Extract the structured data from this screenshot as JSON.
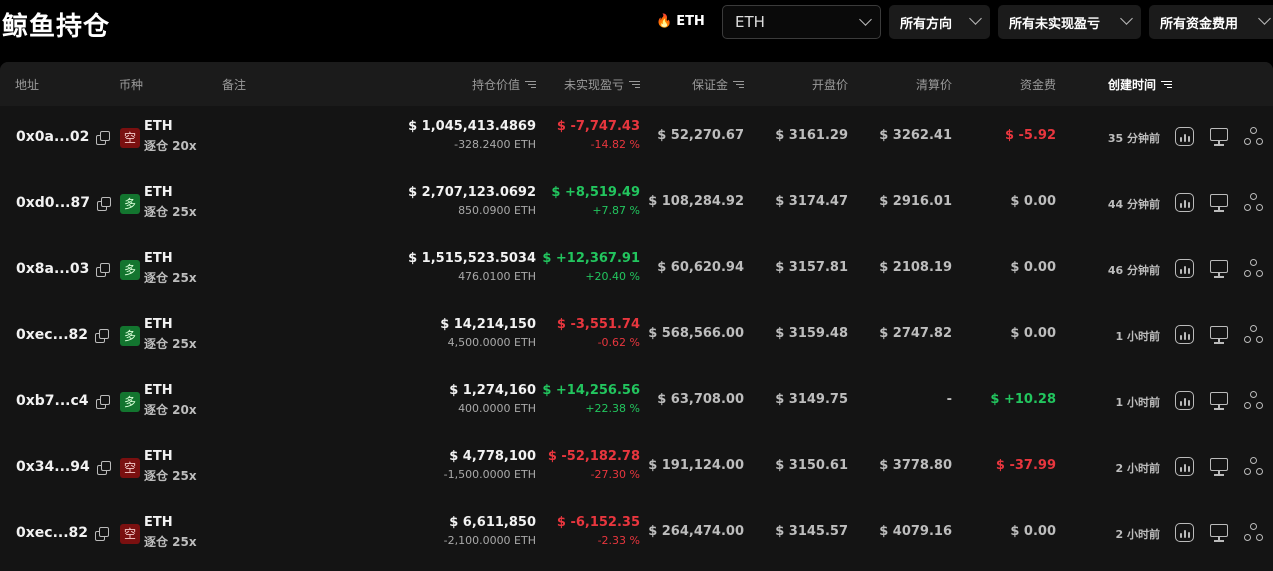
{
  "page": {
    "title": "鲸鱼持仓"
  },
  "filters": {
    "asset_chip": "ETH",
    "symbol_select": "ETH",
    "direction_select": "所有方向",
    "pnl_select": "所有未实现盈亏",
    "funding_select": "所有资金费用"
  },
  "table": {
    "columns": {
      "address": "地址",
      "coin": "币种",
      "note": "备注",
      "position_value": "持仓价值",
      "unrealized_pnl": "未实现盈亏",
      "margin": "保证金",
      "open_price": "开盘价",
      "liq_price": "清算价",
      "funding": "资金费",
      "created": "创建时间"
    },
    "rows": [
      {
        "address": "0x0a...02",
        "side": "空",
        "side_type": "short",
        "coin": "ETH",
        "leverage": "逐仓 20x",
        "value": "$ 1,045,413.4869",
        "size": "-328.2400 ETH",
        "pnl": "$ -7,747.43",
        "pnl_pct": "-14.82 %",
        "pnl_type": "red",
        "margin": "$ 52,270.67",
        "open": "$ 3161.29",
        "liq": "$ 3262.41",
        "funding": "$ -5.92",
        "funding_type": "red",
        "time": "35 分钟前"
      },
      {
        "address": "0xd0...87",
        "side": "多",
        "side_type": "long",
        "coin": "ETH",
        "leverage": "逐仓 25x",
        "value": "$ 2,707,123.0692",
        "size": "850.0900 ETH",
        "pnl": "$ +8,519.49",
        "pnl_pct": "+7.87 %",
        "pnl_type": "green",
        "margin": "$ 108,284.92",
        "open": "$ 3174.47",
        "liq": "$ 2916.01",
        "funding": "$ 0.00",
        "funding_type": "neutral",
        "time": "44 分钟前"
      },
      {
        "address": "0x8a...03",
        "side": "多",
        "side_type": "long",
        "coin": "ETH",
        "leverage": "逐仓 25x",
        "value": "$ 1,515,523.5034",
        "size": "476.0100 ETH",
        "pnl": "$ +12,367.91",
        "pnl_pct": "+20.40 %",
        "pnl_type": "green",
        "margin": "$ 60,620.94",
        "open": "$ 3157.81",
        "liq": "$ 2108.19",
        "funding": "$ 0.00",
        "funding_type": "neutral",
        "time": "46 分钟前"
      },
      {
        "address": "0xec...82",
        "side": "多",
        "side_type": "long",
        "coin": "ETH",
        "leverage": "逐仓 25x",
        "value": "$ 14,214,150",
        "size": "4,500.0000 ETH",
        "pnl": "$ -3,551.74",
        "pnl_pct": "-0.62 %",
        "pnl_type": "red",
        "margin": "$ 568,566.00",
        "open": "$ 3159.48",
        "liq": "$ 2747.82",
        "funding": "$ 0.00",
        "funding_type": "neutral",
        "time": "1 小时前"
      },
      {
        "address": "0xb7...c4",
        "side": "多",
        "side_type": "long",
        "coin": "ETH",
        "leverage": "逐仓 20x",
        "value": "$ 1,274,160",
        "size": "400.0000 ETH",
        "pnl": "$ +14,256.56",
        "pnl_pct": "+22.38 %",
        "pnl_type": "green",
        "margin": "$ 63,708.00",
        "open": "$ 3149.75",
        "liq": "-",
        "funding": "$ +10.28",
        "funding_type": "green",
        "time": "1 小时前"
      },
      {
        "address": "0x34...94",
        "side": "空",
        "side_type": "short",
        "coin": "ETH",
        "leverage": "逐仓 25x",
        "value": "$ 4,778,100",
        "size": "-1,500.0000 ETH",
        "pnl": "$ -52,182.78",
        "pnl_pct": "-27.30 %",
        "pnl_type": "red",
        "margin": "$ 191,124.00",
        "open": "$ 3150.61",
        "liq": "$ 3778.80",
        "funding": "$ -37.99",
        "funding_type": "red",
        "time": "2 小时前"
      },
      {
        "address": "0xec...82",
        "side": "空",
        "side_type": "short",
        "coin": "ETH",
        "leverage": "逐仓 25x",
        "value": "$ 6,611,850",
        "size": "-2,100.0000 ETH",
        "pnl": "$ -6,152.35",
        "pnl_pct": "-2.33 %",
        "pnl_type": "red",
        "margin": "$ 264,474.00",
        "open": "$ 3145.57",
        "liq": "$ 4079.16",
        "funding": "$ 0.00",
        "funding_type": "neutral",
        "time": "2 小时前"
      }
    ]
  },
  "colors": {
    "background": "#000000",
    "panel": "#141414",
    "header_row": "#1b1b1b",
    "profit": "#22c55e",
    "loss": "#e8363e",
    "short_badge": "#7a1010",
    "long_badge": "#13752f",
    "flame": "#ff7a1a"
  },
  "icons": {
    "row_actions": [
      "chart-icon",
      "monitor-icon",
      "share-icon"
    ],
    "address_action": "copy-icon",
    "asset_chip": "flame-icon",
    "sort": "sort-icon",
    "dropdown": "chevron-down-icon"
  }
}
